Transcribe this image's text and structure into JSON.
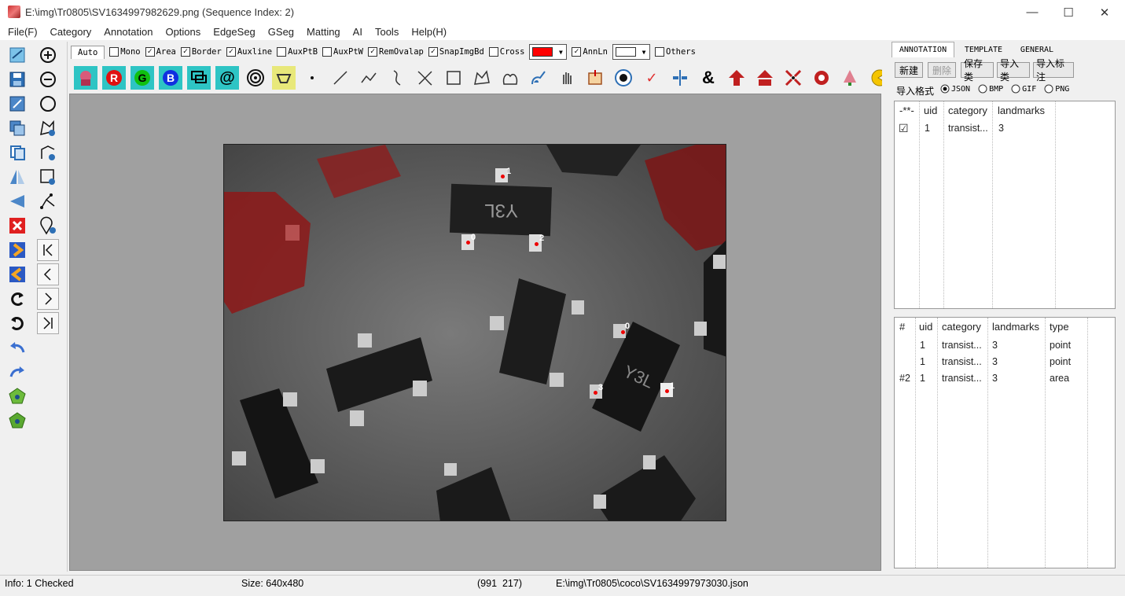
{
  "window": {
    "title": "E:\\img\\Tr0805\\SV1634997982629.png (Sequence Index: 2)",
    "minimize": "—",
    "maximize": "☐",
    "close": "✕"
  },
  "menu": [
    "File(F)",
    "Category",
    "Annotation",
    "Options",
    "EdgeSeg",
    "GSeg",
    "Matting",
    "AI",
    "Tools",
    "Help(H)"
  ],
  "options": {
    "auto_tab": "Auto",
    "items": [
      {
        "label": "Mono",
        "checked": false
      },
      {
        "label": "Area",
        "checked": true
      },
      {
        "label": "Border",
        "checked": true
      },
      {
        "label": "Auxline",
        "checked": true
      },
      {
        "label": "AuxPtB",
        "checked": false
      },
      {
        "label": "AuxPtW",
        "checked": false
      },
      {
        "label": "RemOvalap",
        "checked": true
      },
      {
        "label": "SnapImgBd",
        "checked": true
      },
      {
        "label": "Cross",
        "checked": false
      }
    ],
    "color1": "#ff0000",
    "annln": {
      "label": "AnnLn",
      "checked": true
    },
    "color2": "#ffffff",
    "others": {
      "label": "Others",
      "checked": false
    }
  },
  "right": {
    "tabs": [
      "ANNOTATION",
      "TEMPLATE",
      "GENERAL"
    ],
    "buttons": [
      "新建",
      "删除",
      "保存类",
      "导入类",
      "导入标注"
    ],
    "format_label": "导入格式",
    "formats": [
      "JSON",
      "BMP",
      "GIF",
      "PNG"
    ],
    "top_grid": {
      "headers": [
        "-**-",
        "uid",
        "category",
        "landmarks"
      ],
      "rows": [
        {
          "check": "☑",
          "uid": "1",
          "category": "transist...",
          "landmarks": "3"
        }
      ]
    },
    "bottom_grid": {
      "headers": [
        "#",
        "uid",
        "category",
        "landmarks",
        "type"
      ],
      "rows": [
        {
          "idx": "",
          "uid": "1",
          "category": "transist...",
          "landmarks": "3",
          "type": "point"
        },
        {
          "idx": "",
          "uid": "1",
          "category": "transist...",
          "landmarks": "3",
          "type": "point"
        },
        {
          "idx": "#2",
          "uid": "1",
          "category": "transist...",
          "landmarks": "3",
          "type": "area"
        }
      ]
    }
  },
  "landmarks": [
    "1",
    "0",
    "2",
    "0",
    "3",
    "1"
  ],
  "status": {
    "info": "Info: 1 Checked",
    "size": "Size: 640x480",
    "coords": "(991  217)",
    "path": "E:\\img\\Tr0805\\coco\\SV1634997973030.json"
  },
  "icons": {
    "left_col1": [
      "lasso-icon",
      "save-icon",
      "edit-image-icon",
      "copy-region-icon",
      "duplicate-icon",
      "flip-icon",
      "triangle-left-icon",
      "delete-icon",
      "next-arrow-icon",
      "prev-arrow-icon",
      "redo-curve-icon",
      "undo-curve-icon",
      "undo-icon",
      "redo-icon",
      "green-pentagon-icon",
      "green-pentagon-2-icon"
    ],
    "left_col2": [
      "zoom-in-icon",
      "zoom-out-icon",
      "circle-icon",
      "polygon-add-icon",
      "shape-add-icon",
      "rect-add-icon",
      "graph-icon",
      "pin-add-icon",
      "first-icon",
      "prev-icon",
      "next-icon",
      "last-icon"
    ],
    "top": [
      "portrait-icon",
      "red-channel-icon",
      "green-channel-icon",
      "blue-channel-icon",
      "chat-icon",
      "at-icon",
      "spiral-icon",
      "cut-icon",
      "point-icon",
      "line-icon",
      "polyline-icon",
      "curve-icon",
      "cross-curve-icon",
      "rect-icon",
      "polygon-icon",
      "freeform-icon",
      "brush-icon",
      "hand-icon",
      "crop-icon",
      "target-icon",
      "check-icon",
      "split-icon",
      "ampersand-icon",
      "up-arrow-icon",
      "home-icon",
      "shrink-icon",
      "expand-icon",
      "tree-icon",
      "pacman-icon"
    ]
  }
}
